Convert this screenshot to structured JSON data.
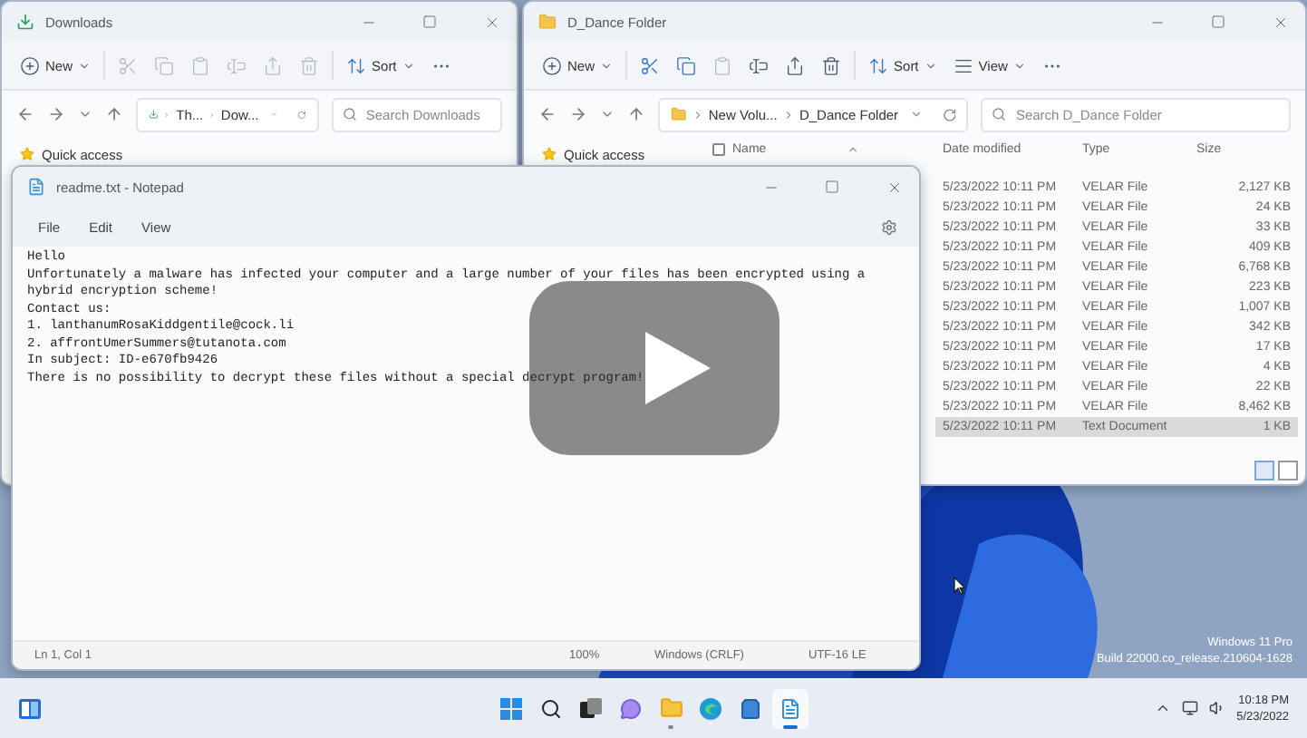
{
  "explorer_windows": [
    {
      "kind": "downloads",
      "title": "Downloads",
      "toolbar": [
        {
          "kind": "new",
          "label": "New",
          "disabled": false
        },
        {
          "kind": "cut",
          "disabled": true
        },
        {
          "kind": "copy",
          "disabled": true
        },
        {
          "kind": "paste",
          "disabled": true
        },
        {
          "kind": "rename",
          "disabled": true
        },
        {
          "kind": "share",
          "disabled": true
        },
        {
          "kind": "delete",
          "disabled": true
        },
        {
          "kind": "sort",
          "label": "Sort",
          "disabled": false
        },
        {
          "kind": "more",
          "disabled": false
        }
      ],
      "breadcrumbs": [
        "Th...",
        "Dow..."
      ],
      "search_placeholder": "Search Downloads",
      "sidebar": [
        "Quick access"
      ]
    },
    {
      "kind": "folder",
      "title": "D_Dance Folder",
      "toolbar": [
        {
          "kind": "new",
          "label": "New",
          "disabled": false
        },
        {
          "kind": "cut",
          "disabled": false
        },
        {
          "kind": "copy",
          "disabled": false
        },
        {
          "kind": "paste",
          "disabled": true
        },
        {
          "kind": "rename",
          "disabled": false
        },
        {
          "kind": "share",
          "disabled": false
        },
        {
          "kind": "delete",
          "disabled": false
        },
        {
          "kind": "sort",
          "label": "Sort",
          "disabled": false
        },
        {
          "kind": "view",
          "label": "View",
          "disabled": false
        },
        {
          "kind": "more",
          "disabled": false
        }
      ],
      "breadcrumbs": [
        "New Volu...",
        "D_Dance Folder"
      ],
      "search_placeholder": "Search D_Dance Folder",
      "sidebar": [
        "Quick access"
      ],
      "columns": [
        "Name",
        "Date modified",
        "Type",
        "Size"
      ],
      "select_all_checked": false,
      "rows": [
        {
          "date": "5/23/2022 10:11 PM",
          "type": "VELAR File",
          "size": "2,127 KB",
          "selected": false
        },
        {
          "date": "5/23/2022 10:11 PM",
          "type": "VELAR File",
          "size": "24 KB",
          "selected": false
        },
        {
          "date": "5/23/2022 10:11 PM",
          "type": "VELAR File",
          "size": "33 KB",
          "selected": false
        },
        {
          "date": "5/23/2022 10:11 PM",
          "type": "VELAR File",
          "size": "409 KB",
          "selected": false
        },
        {
          "date": "5/23/2022 10:11 PM",
          "type": "VELAR File",
          "size": "6,768 KB",
          "selected": false
        },
        {
          "date": "5/23/2022 10:11 PM",
          "type": "VELAR File",
          "size": "223 KB",
          "selected": false
        },
        {
          "date": "5/23/2022 10:11 PM",
          "type": "VELAR File",
          "size": "1,007 KB",
          "selected": false
        },
        {
          "date": "5/23/2022 10:11 PM",
          "type": "VELAR File",
          "size": "342 KB",
          "selected": false
        },
        {
          "date": "5/23/2022 10:11 PM",
          "type": "VELAR File",
          "size": "17 KB",
          "selected": false
        },
        {
          "date": "5/23/2022 10:11 PM",
          "type": "VELAR File",
          "size": "4 KB",
          "selected": false
        },
        {
          "date": "5/23/2022 10:11 PM",
          "type": "VELAR File",
          "size": "22 KB",
          "selected": false
        },
        {
          "date": "5/23/2022 10:11 PM",
          "type": "VELAR File",
          "size": "8,462 KB",
          "selected": false
        },
        {
          "date": "5/23/2022 10:11 PM",
          "type": "Text Document",
          "size": "1 KB",
          "selected": true
        }
      ]
    }
  ],
  "notepad": {
    "title": "readme.txt - Notepad",
    "menu": [
      "File",
      "Edit",
      "View"
    ],
    "lines": [
      "Hello",
      "Unfortunately a malware has infected your computer and a large number of your files has been encrypted using a",
      "hybrid encryption scheme!",
      "Contact us:",
      "1. lanthanumRosaKiddgentile@cock.li",
      "2. affrontUmerSummers@tutanota.com",
      "In subject: ID-e670fb9426",
      "There is no possibility to decrypt these files without a special decrypt program!"
    ],
    "status": [
      "Ln 1, Col 1",
      "100%",
      "Windows (CRLF)",
      "UTF-16 LE"
    ]
  },
  "desktop_watermark": [
    "Windows 11 Pro",
    "Build 22000.co_release.210604-1628"
  ],
  "taskbar": {
    "apps": [
      {
        "kind": "start",
        "running": false,
        "active": false
      },
      {
        "kind": "search",
        "running": false,
        "active": false
      },
      {
        "kind": "taskview",
        "running": false,
        "active": false
      },
      {
        "kind": "chat",
        "running": false,
        "active": false
      },
      {
        "kind": "explorer",
        "running": true,
        "active": false
      },
      {
        "kind": "edge",
        "running": false,
        "active": false
      },
      {
        "kind": "store",
        "running": false,
        "active": false
      },
      {
        "kind": "notepad",
        "running": true,
        "active": true
      }
    ],
    "time": "10:18 PM",
    "date": "5/23/2022"
  }
}
